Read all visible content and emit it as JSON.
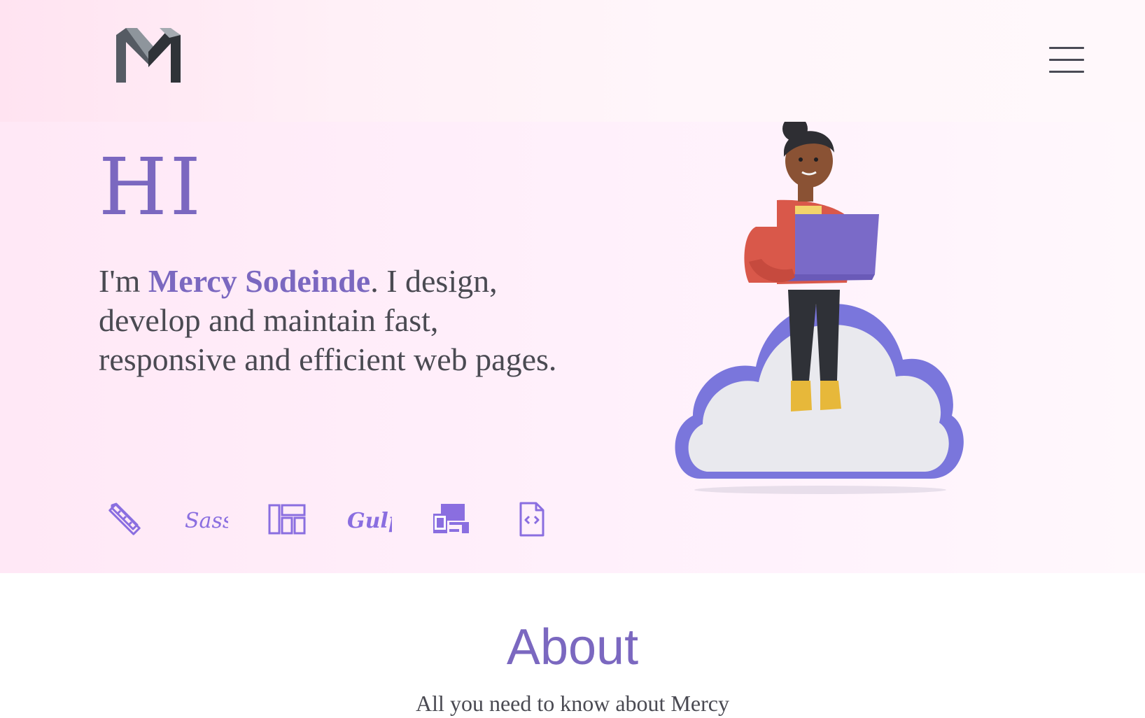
{
  "header": {
    "logo_icon": "m-monogram-logo",
    "menu_icon": "hamburger-menu-icon"
  },
  "hero": {
    "greeting": "HI",
    "intro_prefix": "I'm ",
    "name": "Mercy Sodeinde",
    "intro_suffix": ". I design, develop and maintain fast, responsive and efficient web pages.",
    "skill_icons": [
      "design-tools-icon",
      "sass-icon",
      "layout-icon",
      "gulp-icon",
      "responsive-devices-icon",
      "code-file-icon"
    ],
    "sass_label": "Sass",
    "gulp_label": "Gulp"
  },
  "about": {
    "title": "About",
    "subtitle": "All you need to know about Mercy"
  },
  "colors": {
    "accent": "#7b68c0",
    "text": "#4a4a52",
    "cloud": "#7a76dc"
  }
}
